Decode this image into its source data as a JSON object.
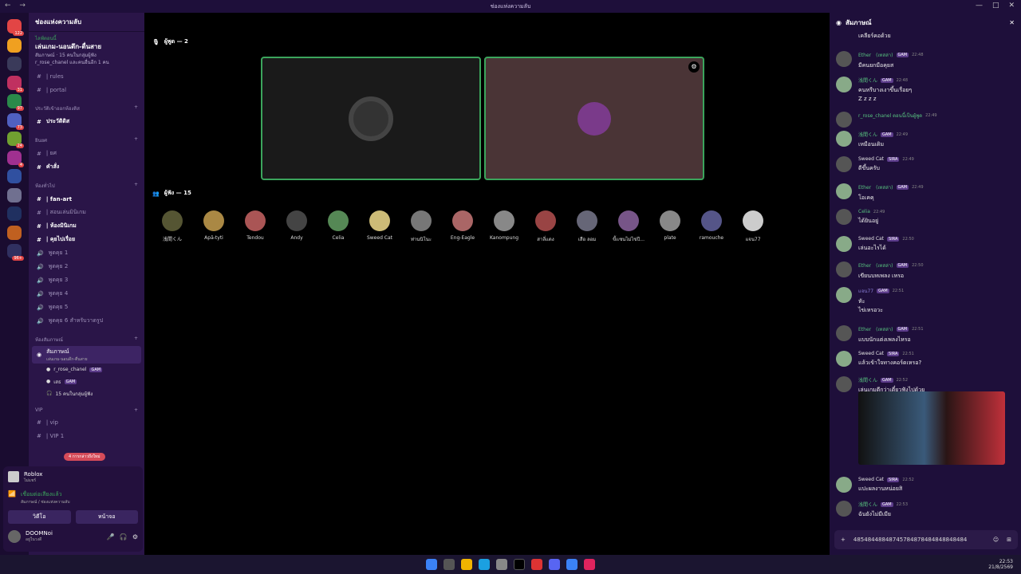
{
  "window": {
    "title": "ช่องแห่งความลับ"
  },
  "servers": [
    {
      "badge": "122"
    },
    {
      "badge": ""
    },
    {
      "badge": ""
    },
    {
      "badge": "31"
    },
    {
      "badge": "97"
    },
    {
      "badge": "73"
    },
    {
      "badge": "24"
    },
    {
      "badge": "4"
    },
    {
      "badge": ""
    },
    {
      "badge": ""
    },
    {
      "badge": ""
    },
    {
      "badge": ""
    },
    {
      "badge": "96+"
    }
  ],
  "sidebar": {
    "server_name": "ช่องแห่งความลับ",
    "event_status": "ไลฟ์ตอนนี้",
    "event_title": "เล่นเกม-นอนดึก-ตื่นสาย",
    "event_sub": "สัมภาษณ์ · 15 คนในกลุ่มผู้ฟัง",
    "event_meta": "r_rose_chanel และคนอื่นอีก 1 คน",
    "ch_rules": "| rules",
    "ch_portal": "| portal",
    "cat_history": "ประวัติเข้าออกห้องดิส",
    "ch_history": "ประวัติดิส",
    "cat_rank": "ยินยศ",
    "ch_rank": "| ยศ",
    "ch_cmd": "คำสั่ง",
    "cat_general": "ห้องทั่วไป",
    "ch_fanart": "| fan-art",
    "ch_muted": "| สอนเล่นมินิเกม",
    "ch_minigame": "| ห้องมินิเกม",
    "ch_story": "| คุยไปเรื่อย",
    "voice": [
      "พูดคุย 1",
      "พูดคุย 2",
      "พูดคุย 3",
      "พูดคุย 4",
      "พูดคุย 5",
      "พูดคุย 6 สำหรับวาดรูป"
    ],
    "cat_stage": "ห้องสัมภาษณ์",
    "stage_name": "สัมภาษณ์",
    "stage_sub": "เล่นเกม-นอนดึก-ตื่นสาย",
    "stage_members": [
      {
        "name": "r_rose_chanel",
        "tag": "GAM"
      },
      {
        "name": "เสธ",
        "tag": "GAM"
      }
    ],
    "stage_listeners": "15 คนในกลุ่มผู้ฟัง",
    "cat_vip": "VIP",
    "ch_vip1": "| vip",
    "ch_vip2": "| VIP 1",
    "unread": "4 การกล่าวถึงใหม่",
    "activity_name": "Roblox",
    "activity_status": "ไม่แชร์",
    "voice_status": "เชื่อมต่อเสียงแล้ว",
    "voice_location": "สัมภาษณ์ / ช่องแห่งความลับ",
    "video_btn": "วิดีโอ",
    "screen_btn": "หน้าจอ",
    "user_name": "DOOMNoi",
    "user_status": "อยู่ในวงดี"
  },
  "stage": {
    "speakers_label": "ผู้พูด — 2",
    "audience_label": "ผู้ฟัง — 15",
    "audience": [
      "浅間くん",
      "Apā-tyti",
      "Tendou",
      "Andy",
      "Celia",
      "Sweed Cat",
      "ท่านนิโนะ",
      "Eng-Eagle",
      "Kanompung",
      "สาลี่แดง",
      "เสือ ลอม",
      "ขี้เเซนไม่ไข่ปี...",
      "plate",
      "ramouche",
      "แจน77"
    ]
  },
  "chat": {
    "title": "สัมภาษณ์",
    "top": "เคลียร์คอด้วย",
    "messages": [
      {
        "name": "Ether　(เทสล่า)",
        "tag": "GAM",
        "time": "22:48",
        "text": [
          "มีคนยกมือคุยส"
        ],
        "color": "#57c27f"
      },
      {
        "name": "浅間くん",
        "tag": "GAM",
        "time": "22:48",
        "text": [
          "คนหรืบางเงาขึ้นเรื่อยๆ",
          "Z z z z"
        ],
        "color": "#57c27f"
      },
      {
        "name": "r_rose_chanel ตอนนี้เป็นผู้พูด",
        "tag": "",
        "time": "22:49",
        "text": [],
        "color": "#57c27f"
      },
      {
        "name": "浅間くん",
        "tag": "GAM",
        "time": "22:49",
        "text": [
          "เหมือนเดิม"
        ],
        "color": "#57c27f"
      },
      {
        "name": "Sweed Cat",
        "tag": "SIRA",
        "time": "22:49",
        "text": [
          "ดีขึ้นครับ"
        ],
        "color": "#e6e6e6"
      },
      {
        "name": "Ether　(เทสล่า)",
        "tag": "GAM",
        "time": "22:49",
        "text": [
          "โอเคคุ"
        ],
        "color": "#57c27f"
      },
      {
        "name": "Celia",
        "tag": "",
        "time": "22:49",
        "text": [
          "ได้ยินอยู่"
        ],
        "color": "#57c27f"
      },
      {
        "name": "Sweed Cat",
        "tag": "SIRA",
        "time": "22:50",
        "text": [
          "เล่นอะไรได้"
        ],
        "color": "#e6e6e6"
      },
      {
        "name": "Ether　(เทสล่า)",
        "tag": "GAM",
        "time": "22:50",
        "text": [
          "เขียนบทเพลง เหรอ"
        ],
        "color": "#57c27f"
      },
      {
        "name": "แจน77",
        "tag": "GAM",
        "time": "22:51",
        "text": [
          "หัะ",
          "ไข่เหรอวะ"
        ],
        "color": "#8a7fd8"
      },
      {
        "name": "Ether　(เทสล่า)",
        "tag": "GAM",
        "time": "22:51",
        "text": [
          "แบบนักแต่งเพลงไหรอ"
        ],
        "color": "#57c27f"
      },
      {
        "name": "Sweed Cat",
        "tag": "SIRA",
        "time": "22:51",
        "text": [
          "แล้วเข้าใจทางคอร์ดเหรอ?"
        ],
        "color": "#e6e6e6"
      },
      {
        "name": "浅間くん",
        "tag": "GAM",
        "time": "22:52",
        "text": [
          "เล่นเกมดีกว่าเดี๋ยวฟังไปด้วย"
        ],
        "color": "#57c27f"
      },
      {
        "name": "Sweed Cat",
        "tag": "SIRA",
        "time": "22:52",
        "text": [
          "แปะผลงานหน่อยสิ"
        ],
        "color": "#e6e6e6"
      },
      {
        "name": "浅間くん",
        "tag": "GAM",
        "time": "22:53",
        "text": [
          "ฉันยังไม่มีเมีย"
        ],
        "color": "#57c27f"
      }
    ],
    "input_value": "48548448848745784878484848848484"
  },
  "taskbar": {
    "time": "22:53",
    "date": "21/8/2569"
  }
}
